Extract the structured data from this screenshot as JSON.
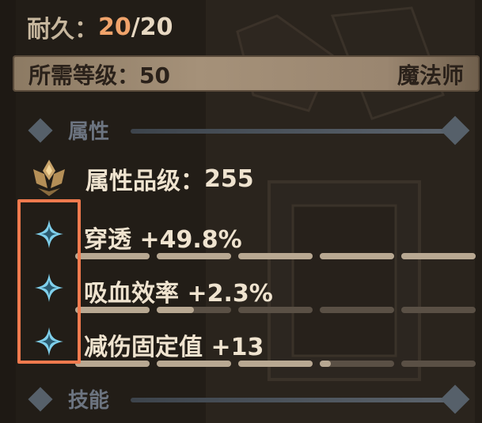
{
  "durability": {
    "label": "耐久：",
    "current": "20",
    "separator": "/",
    "max": "20"
  },
  "requirement": {
    "label": "所需等级：",
    "level": "50",
    "class": "魔法师"
  },
  "sections": {
    "attributes": "属性",
    "skills": "技能"
  },
  "attribute_grade": {
    "label": "属性品级：",
    "value": "255",
    "icon": "lotus-crown-icon"
  },
  "attributes": [
    {
      "name": "穿透",
      "value": "+49.8%",
      "icon": "blue-sparkle-icon",
      "fill": [
        1,
        1,
        1,
        1,
        1
      ]
    },
    {
      "name": "吸血效率",
      "value": "+2.3%",
      "icon": "blue-sparkle-icon",
      "fill": [
        1,
        0.5,
        0,
        0,
        0
      ]
    },
    {
      "name": "减伤固定值",
      "value": "+13",
      "icon": "blue-sparkle-icon",
      "fill": [
        1,
        1,
        1,
        0.15,
        0
      ]
    }
  ],
  "colors": {
    "highlight": "#f07a4e",
    "accent_value": "#f0a36b",
    "icon_blue": "#7fd0ec"
  }
}
